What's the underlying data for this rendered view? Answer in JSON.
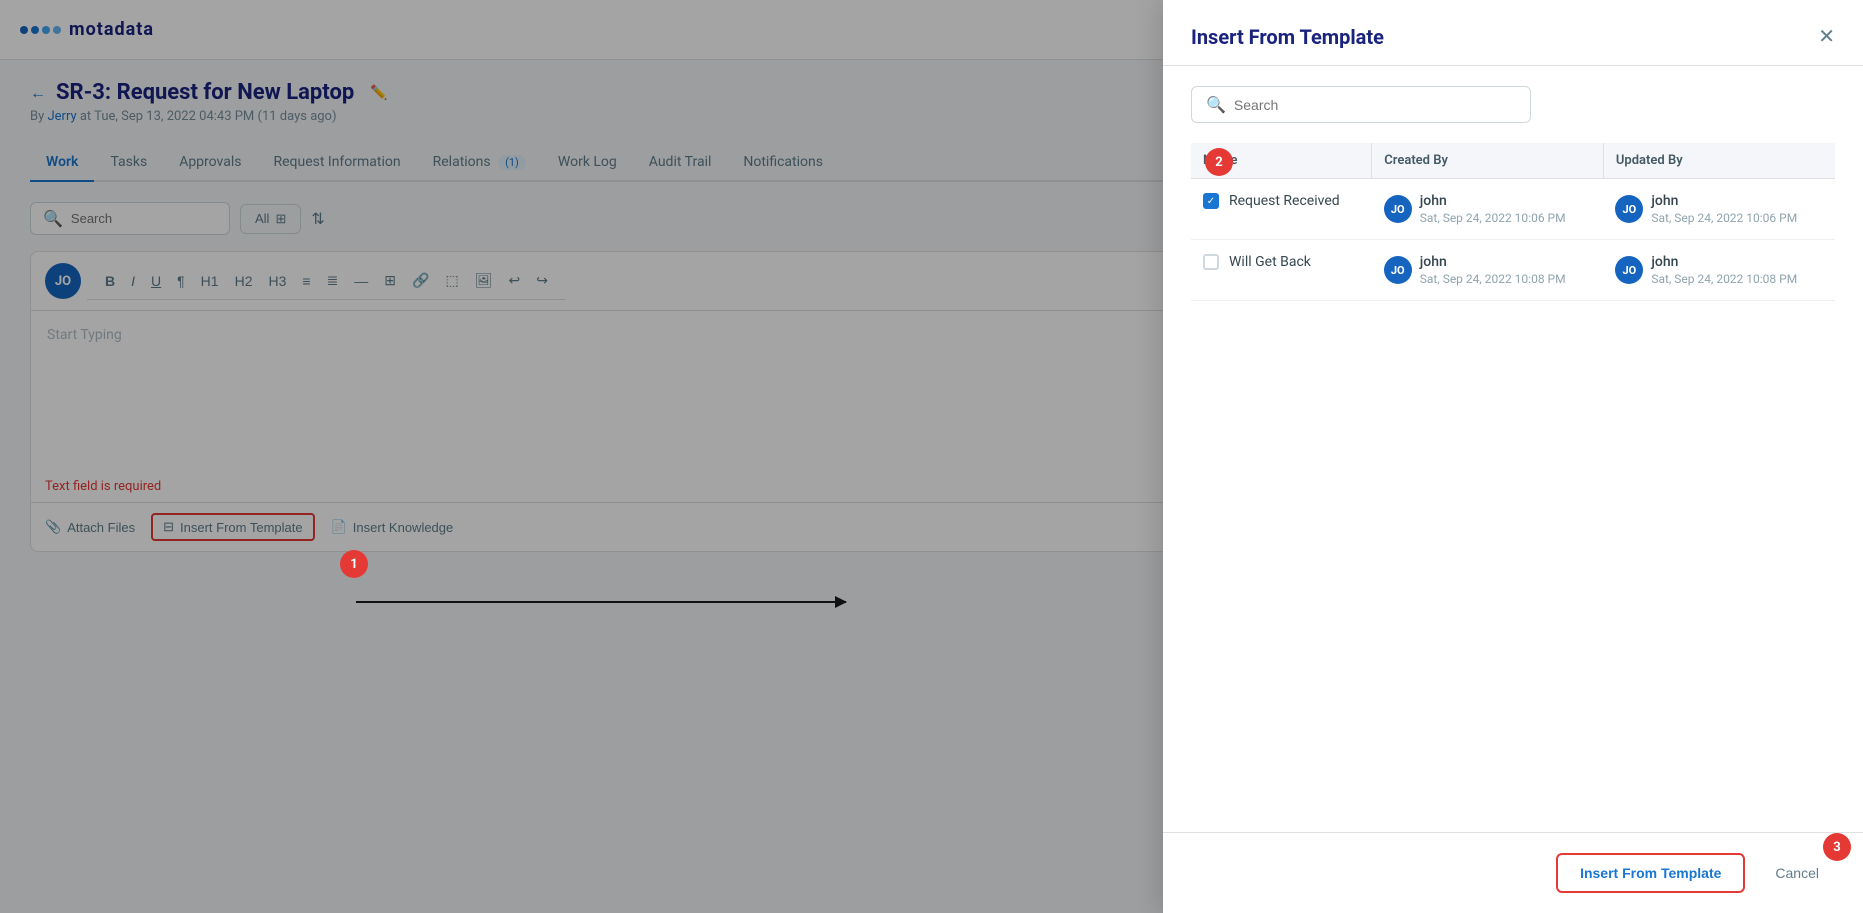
{
  "app": {
    "logo_text": "motadata",
    "logo_dots": [
      "#1a56a0",
      "#1976d2",
      "#42a5f5",
      "#64b5f6"
    ]
  },
  "page": {
    "back_label": "←",
    "title": "SR-3: Request for New Laptop",
    "subtitle_prefix": "By",
    "author": "Jerry",
    "subtitle_mid": "at Tue, Sep 13, 2022 04:43 PM (11 days ago)"
  },
  "tabs": [
    {
      "label": "Work",
      "active": true,
      "badge": null
    },
    {
      "label": "Tasks",
      "active": false,
      "badge": null
    },
    {
      "label": "Approvals",
      "active": false,
      "badge": null
    },
    {
      "label": "Request Information",
      "active": false,
      "badge": null
    },
    {
      "label": "Relations",
      "active": false,
      "badge": "(1)"
    },
    {
      "label": "Work Log",
      "active": false,
      "badge": null
    },
    {
      "label": "Audit Trail",
      "active": false,
      "badge": null
    },
    {
      "label": "Notifications",
      "active": false,
      "badge": null
    }
  ],
  "toolbar": {
    "search_placeholder": "Search",
    "filter_label": "All",
    "filter_icon": "⊞"
  },
  "editor": {
    "avatar_initials": "JO",
    "tools": [
      "B",
      "I",
      "U",
      "¶",
      "H1",
      "H2",
      "H3",
      "≡",
      "≣",
      "—",
      "⊞",
      "🔗",
      "⬚",
      "🖼",
      "↩",
      "↪"
    ],
    "placeholder": "Start Typing",
    "error": "Text field is required",
    "attach_label": "Attach Files",
    "insert_template_label": "Insert From Template",
    "insert_knowledge_label": "Insert Knowledge"
  },
  "steps": {
    "badge_1": "1",
    "badge_2": "2",
    "badge_3": "3"
  },
  "modal": {
    "title": "Insert From Template",
    "close_label": "✕",
    "search_placeholder": "Search",
    "table": {
      "col_name": "Name",
      "col_created": "Created By",
      "col_updated": "Updated By",
      "rows": [
        {
          "checked": true,
          "name": "Request Received",
          "created_by": "john",
          "created_date": "Sat, Sep 24, 2022 10:06 PM",
          "updated_by": "john",
          "updated_date": "Sat, Sep 24, 2022 10:06 PM",
          "created_initials": "JO",
          "updated_initials": "JO"
        },
        {
          "checked": false,
          "name": "Will Get Back",
          "created_by": "john",
          "created_date": "Sat, Sep 24, 2022 10:08 PM",
          "updated_by": "john",
          "updated_date": "Sat, Sep 24, 2022 10:08 PM",
          "created_initials": "JO",
          "updated_initials": "JO"
        }
      ]
    },
    "footer": {
      "insert_label": "Insert From Template",
      "cancel_label": "Cancel"
    }
  }
}
